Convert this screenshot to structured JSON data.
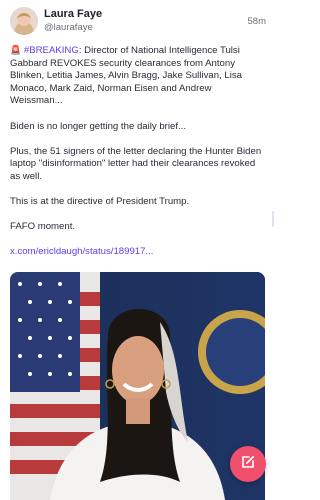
{
  "author": {
    "name": "Laura Faye",
    "handle": "@laurafaye"
  },
  "timestamp": "58m",
  "post": {
    "siren": "🚨",
    "hashtag": "#BREAKING",
    "headline_rest": ": Director of National Intelligence Tulsi Gabbard REVOKES security clearances from Antony Blinken, Letitia James, Alvin Bragg, Jake Sullivan, Lisa Monaco, Mark Zaid, Norman Eisen and Andrew Weissman...",
    "paragraph_2": "Biden is no longer getting the daily brief...",
    "paragraph_3": "Plus, the 51 signers of the letter declaring the Hunter Biden laptop \"disinformation\" letter had their clearances revoked as well.",
    "paragraph_4": "This is at the directive of President Trump.",
    "paragraph_5": "FAFO moment.",
    "link": "x.com/ericldaugh/status/189917..."
  },
  "colors": {
    "accent": "#5b3ee6",
    "fab": "#f0506e"
  },
  "icons": {
    "fab": "compose-icon"
  }
}
